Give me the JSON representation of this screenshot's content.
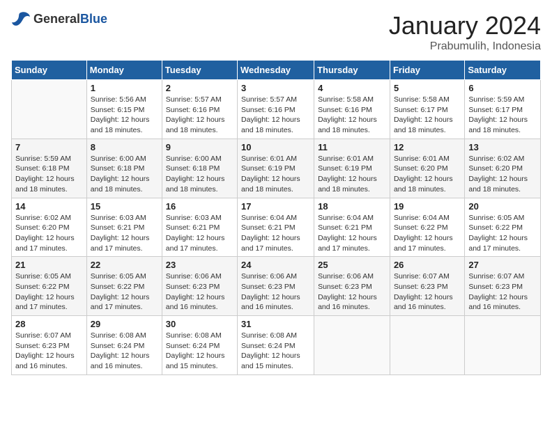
{
  "header": {
    "logo_general": "General",
    "logo_blue": "Blue",
    "month": "January 2024",
    "location": "Prabumulih, Indonesia"
  },
  "weekdays": [
    "Sunday",
    "Monday",
    "Tuesday",
    "Wednesday",
    "Thursday",
    "Friday",
    "Saturday"
  ],
  "weeks": [
    [
      {
        "day": "",
        "content": ""
      },
      {
        "day": "1",
        "content": "Sunrise: 5:56 AM\nSunset: 6:15 PM\nDaylight: 12 hours\nand 18 minutes."
      },
      {
        "day": "2",
        "content": "Sunrise: 5:57 AM\nSunset: 6:16 PM\nDaylight: 12 hours\nand 18 minutes."
      },
      {
        "day": "3",
        "content": "Sunrise: 5:57 AM\nSunset: 6:16 PM\nDaylight: 12 hours\nand 18 minutes."
      },
      {
        "day": "4",
        "content": "Sunrise: 5:58 AM\nSunset: 6:16 PM\nDaylight: 12 hours\nand 18 minutes."
      },
      {
        "day": "5",
        "content": "Sunrise: 5:58 AM\nSunset: 6:17 PM\nDaylight: 12 hours\nand 18 minutes."
      },
      {
        "day": "6",
        "content": "Sunrise: 5:59 AM\nSunset: 6:17 PM\nDaylight: 12 hours\nand 18 minutes."
      }
    ],
    [
      {
        "day": "7",
        "content": "Sunrise: 5:59 AM\nSunset: 6:18 PM\nDaylight: 12 hours\nand 18 minutes."
      },
      {
        "day": "8",
        "content": "Sunrise: 6:00 AM\nSunset: 6:18 PM\nDaylight: 12 hours\nand 18 minutes."
      },
      {
        "day": "9",
        "content": "Sunrise: 6:00 AM\nSunset: 6:18 PM\nDaylight: 12 hours\nand 18 minutes."
      },
      {
        "day": "10",
        "content": "Sunrise: 6:01 AM\nSunset: 6:19 PM\nDaylight: 12 hours\nand 18 minutes."
      },
      {
        "day": "11",
        "content": "Sunrise: 6:01 AM\nSunset: 6:19 PM\nDaylight: 12 hours\nand 18 minutes."
      },
      {
        "day": "12",
        "content": "Sunrise: 6:01 AM\nSunset: 6:20 PM\nDaylight: 12 hours\nand 18 minutes."
      },
      {
        "day": "13",
        "content": "Sunrise: 6:02 AM\nSunset: 6:20 PM\nDaylight: 12 hours\nand 18 minutes."
      }
    ],
    [
      {
        "day": "14",
        "content": "Sunrise: 6:02 AM\nSunset: 6:20 PM\nDaylight: 12 hours\nand 17 minutes."
      },
      {
        "day": "15",
        "content": "Sunrise: 6:03 AM\nSunset: 6:21 PM\nDaylight: 12 hours\nand 17 minutes."
      },
      {
        "day": "16",
        "content": "Sunrise: 6:03 AM\nSunset: 6:21 PM\nDaylight: 12 hours\nand 17 minutes."
      },
      {
        "day": "17",
        "content": "Sunrise: 6:04 AM\nSunset: 6:21 PM\nDaylight: 12 hours\nand 17 minutes."
      },
      {
        "day": "18",
        "content": "Sunrise: 6:04 AM\nSunset: 6:21 PM\nDaylight: 12 hours\nand 17 minutes."
      },
      {
        "day": "19",
        "content": "Sunrise: 6:04 AM\nSunset: 6:22 PM\nDaylight: 12 hours\nand 17 minutes."
      },
      {
        "day": "20",
        "content": "Sunrise: 6:05 AM\nSunset: 6:22 PM\nDaylight: 12 hours\nand 17 minutes."
      }
    ],
    [
      {
        "day": "21",
        "content": "Sunrise: 6:05 AM\nSunset: 6:22 PM\nDaylight: 12 hours\nand 17 minutes."
      },
      {
        "day": "22",
        "content": "Sunrise: 6:05 AM\nSunset: 6:22 PM\nDaylight: 12 hours\nand 17 minutes."
      },
      {
        "day": "23",
        "content": "Sunrise: 6:06 AM\nSunset: 6:23 PM\nDaylight: 12 hours\nand 16 minutes."
      },
      {
        "day": "24",
        "content": "Sunrise: 6:06 AM\nSunset: 6:23 PM\nDaylight: 12 hours\nand 16 minutes."
      },
      {
        "day": "25",
        "content": "Sunrise: 6:06 AM\nSunset: 6:23 PM\nDaylight: 12 hours\nand 16 minutes."
      },
      {
        "day": "26",
        "content": "Sunrise: 6:07 AM\nSunset: 6:23 PM\nDaylight: 12 hours\nand 16 minutes."
      },
      {
        "day": "27",
        "content": "Sunrise: 6:07 AM\nSunset: 6:23 PM\nDaylight: 12 hours\nand 16 minutes."
      }
    ],
    [
      {
        "day": "28",
        "content": "Sunrise: 6:07 AM\nSunset: 6:23 PM\nDaylight: 12 hours\nand 16 minutes."
      },
      {
        "day": "29",
        "content": "Sunrise: 6:08 AM\nSunset: 6:24 PM\nDaylight: 12 hours\nand 16 minutes."
      },
      {
        "day": "30",
        "content": "Sunrise: 6:08 AM\nSunset: 6:24 PM\nDaylight: 12 hours\nand 15 minutes."
      },
      {
        "day": "31",
        "content": "Sunrise: 6:08 AM\nSunset: 6:24 PM\nDaylight: 12 hours\nand 15 minutes."
      },
      {
        "day": "",
        "content": ""
      },
      {
        "day": "",
        "content": ""
      },
      {
        "day": "",
        "content": ""
      }
    ]
  ]
}
